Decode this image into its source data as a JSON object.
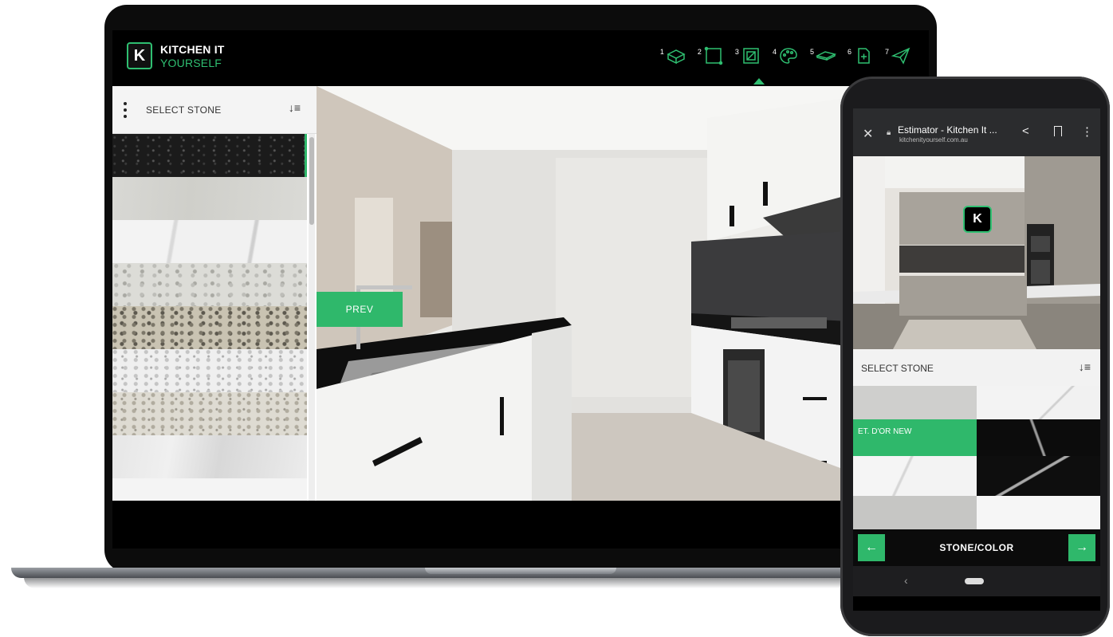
{
  "laptop": {
    "brand": {
      "logo_letter": "K",
      "title": "KITCHEN IT",
      "subtitle": "YOURSELF"
    },
    "steps": [
      {
        "number": "1",
        "icon": "cabinet-icon"
      },
      {
        "number": "2",
        "icon": "layout-icon"
      },
      {
        "number": "3",
        "icon": "dimensions-icon"
      },
      {
        "number": "4",
        "icon": "palette-icon",
        "active": true
      },
      {
        "number": "5",
        "icon": "benchtop-icon"
      },
      {
        "number": "6",
        "icon": "quote-icon"
      },
      {
        "number": "7",
        "icon": "send-icon"
      }
    ],
    "sidebar": {
      "title": "SELECT STONE"
    },
    "prev_label": "PREV"
  },
  "phone": {
    "browser": {
      "title": "Estimator - Kitchen It ...",
      "url": "kitchenityourself.com.au"
    },
    "logo_letter": "K",
    "panel_title": "SELECT STONE",
    "selected_swatch_label": "ET. D'OR NEW",
    "nav_label": "STONE/COLOR",
    "prev_arrow": "←",
    "next_arrow": "→"
  },
  "colors": {
    "accent": "#2fb86b",
    "header_bg": "#000000"
  }
}
